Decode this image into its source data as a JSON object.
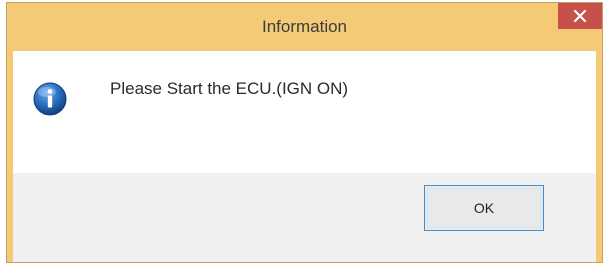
{
  "window": {
    "title": "Information",
    "close_icon": "close-icon"
  },
  "dialog": {
    "icon": "info-icon",
    "message": "Please Start the ECU.(IGN ON)"
  },
  "buttons": {
    "ok_label": "OK"
  },
  "colors": {
    "titlebar": "#f4ca76",
    "close_button": "#c7504b",
    "info_icon": "#1e5fae",
    "footer": "#f0f0f0",
    "focus_border": "#3f8fd6"
  }
}
